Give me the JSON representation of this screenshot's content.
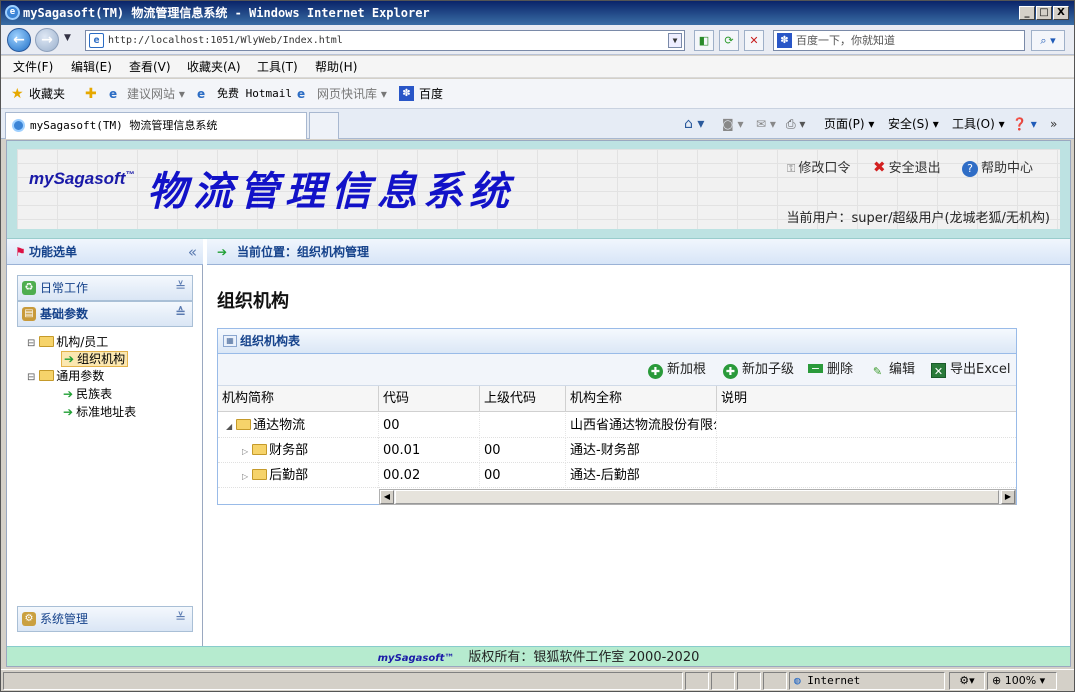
{
  "window": {
    "title": "mySagasoft(TM) 物流管理信息系统 - Windows Internet Explorer",
    "min": "_",
    "max": "□",
    "close": "X"
  },
  "address": {
    "url": "http://localhost:1051/WlyWeb/Index.html",
    "search_placeholder": "百度一下，你就知道"
  },
  "menu": [
    "文件(F)",
    "编辑(E)",
    "查看(V)",
    "收藏夹(A)",
    "工具(T)",
    "帮助(H)"
  ],
  "favorites": {
    "label": "收藏夹",
    "items": [
      "建议网站 ▾",
      "免费 Hotmail",
      "网页快讯库 ▾",
      "百度"
    ]
  },
  "tab": {
    "title": "mySagasoft(TM) 物流管理信息系统",
    "tools": [
      "页面(P) ▾",
      "安全(S) ▾",
      "工具(O) ▾"
    ]
  },
  "header": {
    "logo": "mySagasoft",
    "logo_tm": "™",
    "title": "物流管理信息系统",
    "links": {
      "change_password": "修改口令",
      "logout": "安全退出",
      "help": "帮助中心"
    },
    "current_user": "当前用户：super/超级用户(龙城老狐/无机构)"
  },
  "left": {
    "title": "功能选单",
    "sections": {
      "daily": "日常工作",
      "basic": "基础参数",
      "system": "系统管理"
    },
    "tree": {
      "org_staff": "机构/员工",
      "org": "组织机构",
      "common": "通用参数",
      "ethnic": "民族表",
      "address": "标准地址表"
    }
  },
  "main": {
    "breadcrumb": "当前位置：组织机构管理",
    "page_title": "组织机构",
    "grid_title": "组织机构表",
    "tools": {
      "add_root": "新加根",
      "add_child": "新加子级",
      "delete": "删除",
      "edit": "编辑",
      "export": "导出Excel"
    },
    "columns": [
      "机构简称",
      "代码",
      "上级代码",
      "机构全称",
      "说明"
    ],
    "rows": [
      {
        "name": "通达物流",
        "code": "00",
        "parent": "",
        "full": "山西省通达物流股份有限公司",
        "desc": "",
        "toggle": "◢"
      },
      {
        "name": "财务部",
        "code": "00.01",
        "parent": "00",
        "full": "通达-财务部",
        "desc": "",
        "toggle": "▷"
      },
      {
        "name": "后勤部",
        "code": "00.02",
        "parent": "00",
        "full": "通达-后勤部",
        "desc": "",
        "toggle": "▷"
      }
    ]
  },
  "footer": {
    "logo": "mySagasoft™",
    "text": "版权所有：银狐软件工作室 2000-2020"
  },
  "status": {
    "zone": "Internet",
    "zoom": "100%"
  }
}
